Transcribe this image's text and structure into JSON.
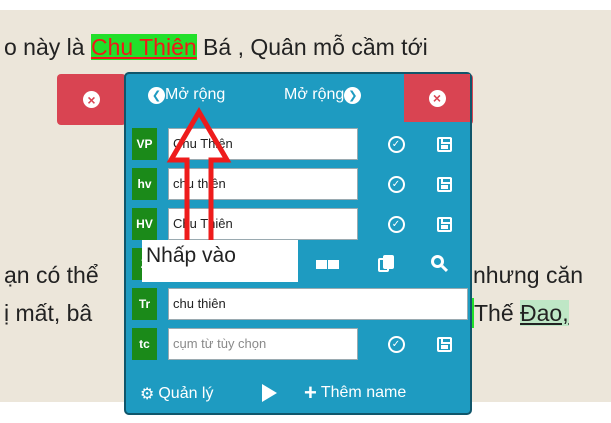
{
  "text_lines": [
    {
      "before": "o này là ",
      "highlight": "Chu Thiên",
      "after": " Bá , Quân mỗ cầm tới"
    },
    {
      "text": "ạn có thể",
      "tail": "nhưng căn"
    },
    {
      "text": "ị mất, bâ",
      "tail_a": "Thế ",
      "tail_b": "Đao,"
    }
  ],
  "popup": {
    "back_label": "Mở rộng",
    "expand_label": "Mở rộng",
    "rows": [
      {
        "tag": "VP",
        "value": "Chu Thiên"
      },
      {
        "tag": "hv",
        "value": "chu thiên"
      },
      {
        "tag": "HV",
        "value": "Chu Thiên"
      },
      {
        "tag": "Z",
        "value": ""
      },
      {
        "tag": "Tr",
        "value": "chu thiên"
      },
      {
        "tag": "tc",
        "placeholder": "cụm từ tùy chọn"
      }
    ],
    "footer": {
      "manage": "Quản lý",
      "add_name": "Thêm name"
    }
  },
  "annotation": {
    "text": "Nhấp vào",
    "color": "#ee1c1c"
  },
  "colors": {
    "popup_bg": "#1e9bc1",
    "close_red": "#d94452",
    "tag_green": "#1b8a19",
    "reader_bg": "#ece6da"
  }
}
